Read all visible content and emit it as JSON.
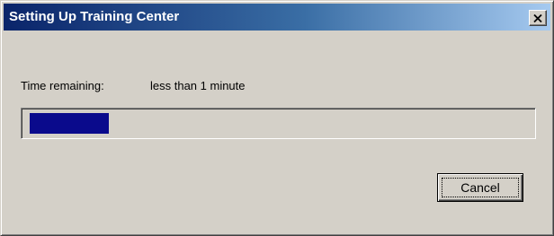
{
  "window": {
    "title": "Setting Up Training Center",
    "close_icon": "close-icon"
  },
  "status": {
    "time_label": "Time remaining:",
    "time_value": "less than 1 minute"
  },
  "progress": {
    "fraction": 0.16,
    "fill_color": "#0a0a8c"
  },
  "buttons": {
    "cancel_label": "Cancel"
  },
  "colors": {
    "title_gradient_start": "#0a246a",
    "title_gradient_end": "#a6caf0",
    "face": "#d4d0c8"
  }
}
